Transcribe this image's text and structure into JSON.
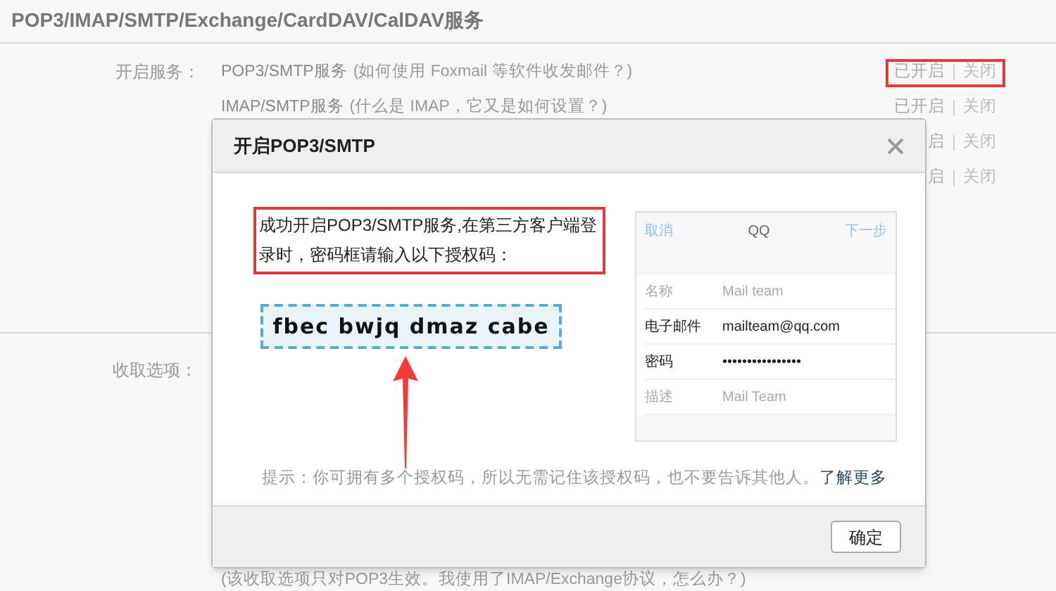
{
  "page": {
    "title": "POP3/IMAP/SMTP/Exchange/CardDAV/CalDAV服务",
    "services_label": "开启服务：",
    "services": [
      {
        "name": "POP3/SMTP服务",
        "help": "(如何使用 Foxmail 等软件收发邮件？)",
        "status": "已开启",
        "action": "关闭",
        "highlighted": true
      },
      {
        "name": "IMAP/SMTP服务",
        "help": "(什么是 IMAP，它又是如何设置？)",
        "status": "已开启",
        "action": "关闭",
        "highlighted": false
      },
      {
        "status": "启",
        "action": "关闭",
        "highlighted": false
      },
      {
        "status": "启",
        "action": "关闭",
        "highlighted": false
      }
    ],
    "receive_label": "收取选项：",
    "receive_note": "(该收取选项只对POP3生效。我使用了IMAP/Exchange协议，怎么办？)"
  },
  "dialog": {
    "title": "开启POP3/SMTP",
    "instruction": "成功开启POP3/SMTP服务,在第三方客户端登录时，密码框请输入以下授权码：",
    "instruction_highlighted": true,
    "auth_code": "fbec bwjq dmaz cabe",
    "preview": {
      "cancel": "取消",
      "title": "QQ",
      "next": "下一步",
      "fields": [
        {
          "label": "名称",
          "value": "Mail team",
          "filled": false
        },
        {
          "label": "电子邮件",
          "value": "mailteam@qq.com",
          "filled": true
        },
        {
          "label": "密码",
          "value": "••••••••••••••••",
          "filled": true
        },
        {
          "label": "描述",
          "value": "Mail Team",
          "filled": false
        }
      ]
    },
    "hint": "提示：你可拥有多个授权码，所以无需记住该授权码，也不要告诉其他人。",
    "hint_link": "了解更多",
    "confirm": "确定"
  }
}
